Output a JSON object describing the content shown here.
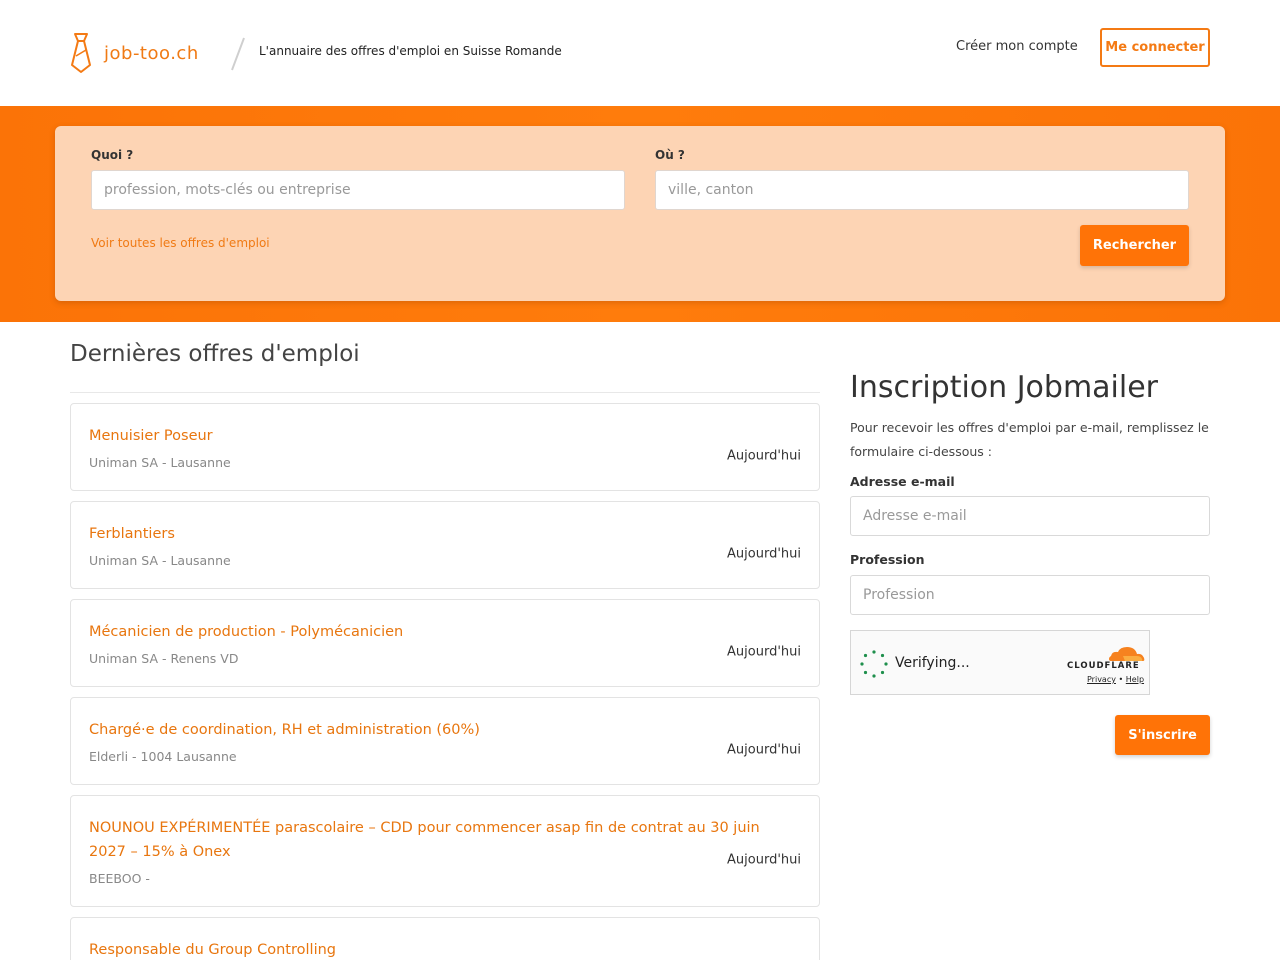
{
  "header": {
    "logo_text": "job-too.ch",
    "tagline": "L'annuaire des offres d'emploi en Suisse Romande",
    "create_account": "Créer mon compte",
    "login": "Me connecter"
  },
  "search": {
    "what_label": "Quoi ?",
    "what_placeholder": "profession, mots-clés ou entreprise",
    "where_label": "Où ?",
    "where_placeholder": "ville, canton",
    "all_offers_link": "Voir toutes les offres d'emploi",
    "search_button": "Rechercher"
  },
  "latest": {
    "title": "Dernières offres d'emploi",
    "jobs": [
      {
        "title": "Menuisier Poseur",
        "company": "Uniman SA - Lausanne",
        "date": "Aujourd'hui"
      },
      {
        "title": "Ferblantiers",
        "company": "Uniman SA - Lausanne",
        "date": "Aujourd'hui"
      },
      {
        "title": "Mécanicien de production - Polymécanicien",
        "company": "Uniman SA - Renens VD",
        "date": "Aujourd'hui"
      },
      {
        "title": "Chargé·e de coordination, RH et administration (60%)",
        "company": "Elderli - 1004 Lausanne",
        "date": "Aujourd'hui"
      },
      {
        "title": "NOUNOU EXPÉRIMENTÉE parascolaire – CDD pour commencer asap fin de contrat au 30 juin 2027 – 15% à Onex",
        "company": "BEEBOO -",
        "date": "Aujourd'hui"
      },
      {
        "title": "Responsable du Group Controlling",
        "company": "",
        "date": ""
      }
    ]
  },
  "jobmailer": {
    "title": "Inscription Jobmailer",
    "description": "Pour recevoir les offres d'emploi par e-mail, remplissez le formulaire ci-dessous :",
    "email_label": "Adresse e-mail",
    "email_placeholder": "Adresse e-mail",
    "profession_label": "Profession",
    "profession_placeholder": "Profession",
    "subscribe_button": "S'inscrire"
  },
  "captcha": {
    "status": "Verifying...",
    "brand": "CLOUDFLARE",
    "privacy": "Privacy",
    "separator": "•",
    "help": "Help"
  },
  "colors": {
    "brand_orange": "#ff7307",
    "link_orange": "#e8760f",
    "panel_peach": "#fdd4b4"
  }
}
